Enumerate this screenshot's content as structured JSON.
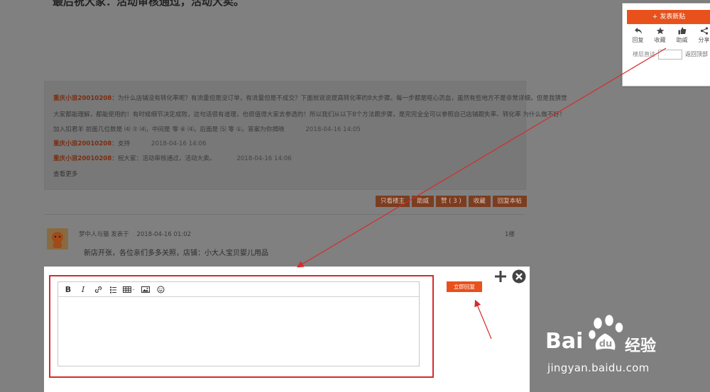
{
  "heading": "最后祝大家：活动审核通过，活动大卖。",
  "comments": {
    "first": {
      "user": "重庆小浪20010208",
      "line1": "：为什么店铺没有转化率呢？有流量但是没订单，有流量但是不成交？下面就说说提高转化率的8大步骤。每一步都是呕心沥血，虽然有些地方不是非常详细，但是我猜觉",
      "line2": "大家都能理解，都能使用的！有时候细节决定成败，这句话很有道理，也很值得大家去参透的！所以我们从以下8个方法跟步骤，是完完全全可以参照自己店铺跟失率、转化率 为什么做不好！",
      "line3": "加入扣君羊 前面几位数是 ⑷ ⑦ ⑷，中间是 零 ⑥ ⑷，后面是 ⑸ 零 ①。答案为你揭晓",
      "time": "2018-04-16 14:05"
    },
    "second": {
      "user": "重庆小浪20010208",
      "text": "：支持",
      "time": "2018-04-16 14:06"
    },
    "third": {
      "user": "重庆小浪20010208",
      "text": "：祝大家：活动审核通过，活动大卖。",
      "time": "2018-04-16 14:06"
    },
    "more": "查看更多"
  },
  "actions": [
    "只看楼主",
    "助威",
    "赞 ( 3 )",
    "收藏",
    "回复本帖"
  ],
  "post": {
    "author": "梦中人与猫",
    "posted_label": "发表于",
    "date": "2018-04-16 01:02",
    "floor": "1楼",
    "text": "新店开张，各位亲们多多关照，店铺：小大人宝贝婴儿用品"
  },
  "editor": {
    "toolbar": [
      "B",
      "I",
      "link",
      "list",
      "table",
      "image",
      "emoji"
    ],
    "submit_label": "立即回复"
  },
  "float_panel": {
    "new_post": "+ 发表新贴",
    "actions": [
      {
        "icon": "reply-icon",
        "label": "回复"
      },
      {
        "icon": "star-icon",
        "label": "收藏"
      },
      {
        "icon": "thumb-up-icon",
        "label": "助威"
      },
      {
        "icon": "share-icon",
        "label": "分享"
      }
    ],
    "jump_label": "楼层直达",
    "top_label": "返回顶部"
  },
  "watermark": {
    "brand": "Bai",
    "jingyan": "经验",
    "url": "jingyan.baidu.com"
  },
  "colors": {
    "accent": "#e8501c",
    "annotation": "#d62b2b"
  }
}
